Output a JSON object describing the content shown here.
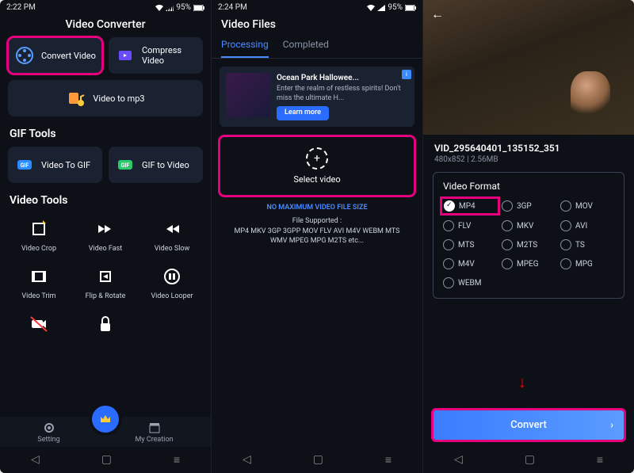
{
  "status": {
    "time1": "2:22 PM",
    "time2": "2:24 PM",
    "batt": "95%"
  },
  "p1": {
    "title": "Video Converter",
    "cards": {
      "convert": "Convert Video",
      "compress": "Compress Video",
      "mp3": "Video to mp3"
    },
    "gif_hdr": "GIF Tools",
    "gif": {
      "togif": "Video To GIF",
      "tovid": "GIF to Video"
    },
    "vid_hdr": "Video Tools",
    "tools": [
      "Video Crop",
      "Video Fast",
      "Video Slow",
      "Video Trim",
      "Flip & Rotate",
      "Video Looper"
    ],
    "nav": {
      "setting": "Setting",
      "my": "My Creation"
    }
  },
  "p2": {
    "title": "Video Files",
    "tabs": {
      "proc": "Processing",
      "comp": "Completed"
    },
    "ad": {
      "title": "Ocean Park Hallowee...",
      "body": "Enter the realm of restless spirits! Don't miss the ultimate H...",
      "btn": "Learn more"
    },
    "select": "Select video",
    "nomax": "NO MAXIMUM VIDEO FILE SIZE",
    "sup_lbl": "File Supported :",
    "sup": "MP4 MKV 3GP 3GPP MOV FLV AVI M4V WEBM MTS WMV MPEG MPG M2TS etc..."
  },
  "p3": {
    "name": "VID_295640401_135152_351",
    "res": "480x852",
    "size": "2.56MB",
    "fmt_hdr": "Video Format",
    "fmts": [
      "MP4",
      "3GP",
      "MOV",
      "FLV",
      "MKV",
      "AVI",
      "MTS",
      "M2TS",
      "TS",
      "M4V",
      "MPEG",
      "MPG",
      "WEBM"
    ],
    "convert": "Convert"
  }
}
